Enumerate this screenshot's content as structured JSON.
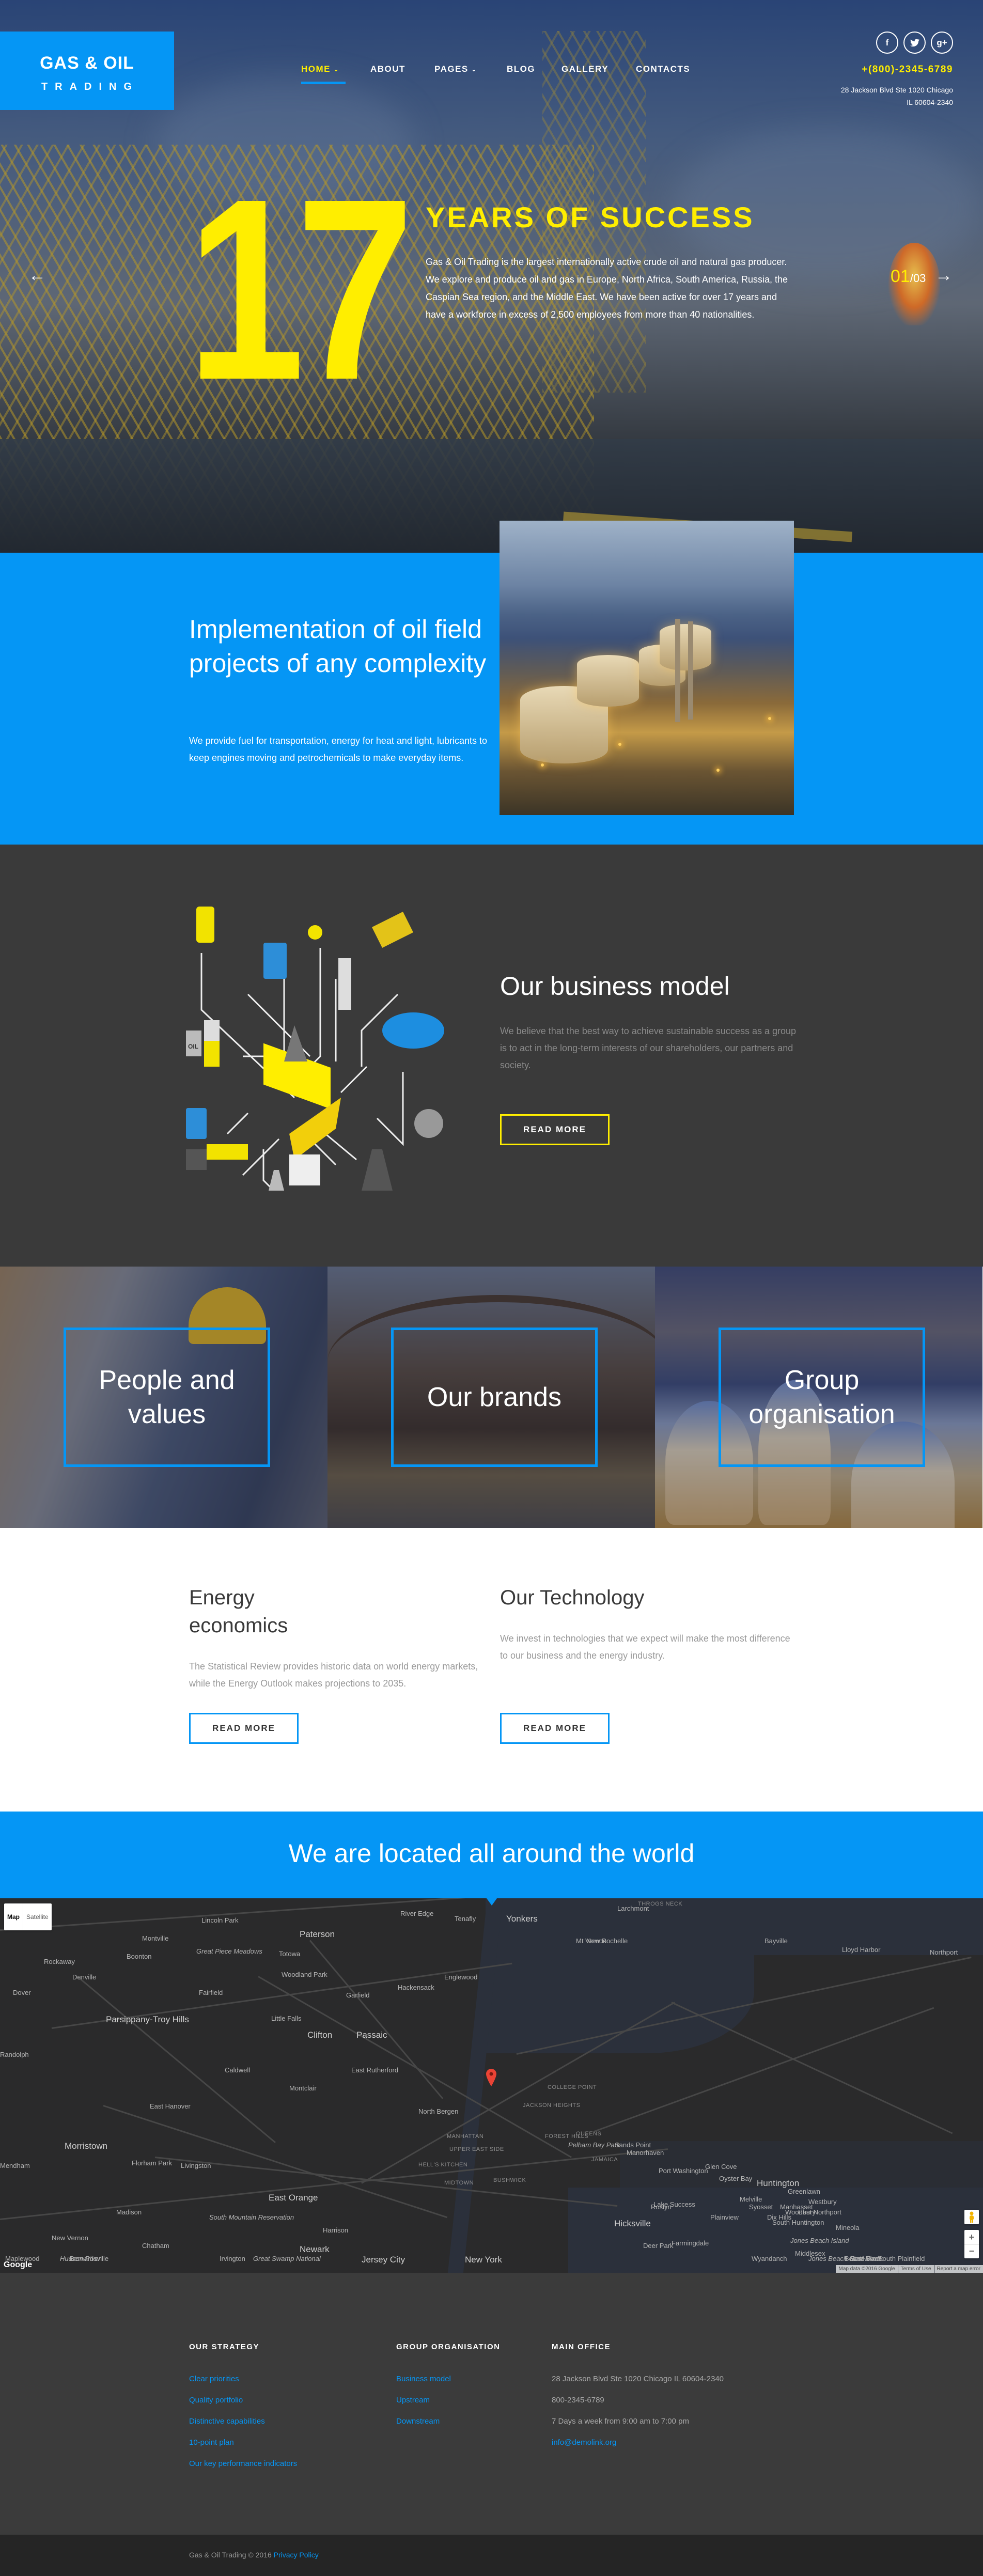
{
  "brand": {
    "line1": "GAS & OIL",
    "line2": "TRADING"
  },
  "nav": {
    "items": [
      {
        "label": "HOME",
        "has_dropdown": true,
        "active": true
      },
      {
        "label": "ABOUT",
        "has_dropdown": false
      },
      {
        "label": "PAGES",
        "has_dropdown": true
      },
      {
        "label": "BLOG",
        "has_dropdown": false
      },
      {
        "label": "GALLERY",
        "has_dropdown": false
      },
      {
        "label": "CONTACTS",
        "has_dropdown": false
      }
    ],
    "caret": "⌄"
  },
  "header": {
    "social": [
      {
        "icon": "facebook-icon",
        "glyph": "f"
      },
      {
        "icon": "twitter-icon",
        "glyph": "t"
      },
      {
        "icon": "google-plus-icon",
        "glyph": "g+"
      }
    ],
    "phone": "+(800)-2345-6789",
    "address_line1": "28 Jackson Blvd Ste 1020 Chicago",
    "address_line2": "IL 60604-2340"
  },
  "hero": {
    "big_number": "17",
    "title": "YEARS OF SUCCESS",
    "text": "Gas & Oil Trading is the largest internationally active crude oil and natural gas producer. We explore and produce oil and gas in Europe, North Africa, South America, Russia, the Caspian Sea region, and the Middle East. We have been active for over 17 years and have a workforce in excess of 2,500 employees from more than 40 nationalities.",
    "slide_current": "01",
    "slide_total": "/03",
    "prev_arrow": "←",
    "next_arrow": "→"
  },
  "implementation": {
    "title": "Implementation of oil field projects of any complexity",
    "text": "We provide fuel for transportation, energy for heat and light, lubricants to keep engines moving and petrochemicals to make everyday items."
  },
  "business_model": {
    "title": "Our business model",
    "text": "We believe that the best way to achieve sustainable success as a group is to act in the long-term interests of our shareholders, our partners and society.",
    "button": "READ MORE",
    "illustration_label": "OIL"
  },
  "tiles": [
    {
      "label": "People and values"
    },
    {
      "label": "Our brands"
    },
    {
      "label": "Group organisation"
    }
  ],
  "info": [
    {
      "title": "Energy economics",
      "text": "The Statistical Review provides historic data on world energy markets, while the Energy Outlook makes projections to 2035.",
      "button": "READ MORE"
    },
    {
      "title": "Our Technology",
      "text": "We invest in technologies that we expect will make the most difference to our business and the energy industry.",
      "button": "READ MORE"
    }
  ],
  "location": {
    "title": "We are located all around the world"
  },
  "map": {
    "type_controls": {
      "map": "Map",
      "satellite": "Satellite",
      "active": "Map"
    },
    "labels": [
      {
        "t": "Lincoln Park",
        "c": ""
      },
      {
        "t": "Montville",
        "c": ""
      },
      {
        "t": "Paterson",
        "c": "big"
      },
      {
        "t": "River Edge",
        "c": ""
      },
      {
        "t": "Tenafly",
        "c": ""
      },
      {
        "t": "Yonkers",
        "c": "big"
      },
      {
        "t": "Larchmont",
        "c": ""
      },
      {
        "t": "Mt Vernon",
        "c": ""
      },
      {
        "t": "New Rochelle",
        "c": ""
      },
      {
        "t": "Bayville",
        "c": ""
      },
      {
        "t": "Lloyd Harbor",
        "c": ""
      },
      {
        "t": "Northport",
        "c": ""
      },
      {
        "t": "Rockaway",
        "c": ""
      },
      {
        "t": "Boonton",
        "c": ""
      },
      {
        "t": "Great Piece Meadows",
        "c": "ital"
      },
      {
        "t": "Totowa",
        "c": ""
      },
      {
        "t": "Denville",
        "c": ""
      },
      {
        "t": "Woodland Park",
        "c": ""
      },
      {
        "t": "Hackensack",
        "c": ""
      },
      {
        "t": "Englewood",
        "c": ""
      },
      {
        "t": "Dover",
        "c": ""
      },
      {
        "t": "Fairfield",
        "c": ""
      },
      {
        "t": "Garfield",
        "c": ""
      },
      {
        "t": "Parsippany-Troy Hills",
        "c": "big"
      },
      {
        "t": "Little Falls",
        "c": ""
      },
      {
        "t": "Clifton",
        "c": "big"
      },
      {
        "t": "Passaic",
        "c": "big"
      },
      {
        "t": "Randolph",
        "c": ""
      },
      {
        "t": "Caldwell",
        "c": ""
      },
      {
        "t": "East Rutherford",
        "c": ""
      },
      {
        "t": "Montclair",
        "c": ""
      },
      {
        "t": "North Bergen",
        "c": ""
      },
      {
        "t": "East Hanover",
        "c": ""
      },
      {
        "t": "MANHATTAN",
        "c": "dist"
      },
      {
        "t": "UPPER EAST SIDE",
        "c": "dist"
      },
      {
        "t": "HELL'S KITCHEN",
        "c": "dist"
      },
      {
        "t": "MIDTOWN",
        "c": "dist"
      },
      {
        "t": "Morristown",
        "c": "big"
      },
      {
        "t": "Florham Park",
        "c": ""
      },
      {
        "t": "Livingston",
        "c": ""
      },
      {
        "t": "Mendham",
        "c": ""
      },
      {
        "t": "East Orange",
        "c": "big"
      },
      {
        "t": "Madison",
        "c": ""
      },
      {
        "t": "South Mountain Reservation",
        "c": "ital"
      },
      {
        "t": "Harrison",
        "c": ""
      },
      {
        "t": "New Vernon",
        "c": ""
      },
      {
        "t": "Chatham",
        "c": ""
      },
      {
        "t": "Newark",
        "c": "big"
      },
      {
        "t": "Jersey City",
        "c": "big"
      },
      {
        "t": "New York",
        "c": "big"
      },
      {
        "t": "Maplewood",
        "c": ""
      },
      {
        "t": "Irvington",
        "c": ""
      },
      {
        "t": "Great Swamp National",
        "c": "ital"
      },
      {
        "t": "Bernardsville",
        "c": ""
      },
      {
        "t": "COLLEGE POINT",
        "c": "dist"
      },
      {
        "t": "JACKSON HEIGHTS",
        "c": "dist"
      },
      {
        "t": "QUEENS",
        "c": "dist"
      },
      {
        "t": "FOREST HILLS",
        "c": "dist"
      },
      {
        "t": "JAMAICA",
        "c": "dist"
      },
      {
        "t": "BUSHWICK",
        "c": "dist"
      },
      {
        "t": "THROGS NECK",
        "c": "dist"
      },
      {
        "t": "Pelham Bay Park",
        "c": "ital"
      },
      {
        "t": "Sands Point",
        "c": ""
      },
      {
        "t": "Manorhaven",
        "c": ""
      },
      {
        "t": "Port Washington",
        "c": ""
      },
      {
        "t": "Glen Cove",
        "c": ""
      },
      {
        "t": "Oyster Bay",
        "c": ""
      },
      {
        "t": "Huntington",
        "c": "big"
      },
      {
        "t": "Greenlawn",
        "c": ""
      },
      {
        "t": "East Northport",
        "c": ""
      },
      {
        "t": "Syosset",
        "c": ""
      },
      {
        "t": "Woodbury",
        "c": ""
      },
      {
        "t": "South Huntington",
        "c": ""
      },
      {
        "t": "Manhasset",
        "c": ""
      },
      {
        "t": "Roslyn",
        "c": ""
      },
      {
        "t": "Lake Success",
        "c": ""
      },
      {
        "t": "Hicksville",
        "c": "big"
      },
      {
        "t": "Plainview",
        "c": ""
      },
      {
        "t": "Melville",
        "c": ""
      },
      {
        "t": "Dix Hills",
        "c": ""
      },
      {
        "t": "Westbury",
        "c": ""
      },
      {
        "t": "Mineola",
        "c": ""
      },
      {
        "t": "Farmingdale",
        "c": ""
      },
      {
        "t": "Deer Park",
        "c": ""
      },
      {
        "t": "Wyandanch",
        "c": ""
      },
      {
        "t": "Jones Beach State Park",
        "c": "ital"
      },
      {
        "t": "Jones Beach Island",
        "c": "ital"
      },
      {
        "t": "Middlesex",
        "c": ""
      },
      {
        "t": "South Plainfield",
        "c": ""
      },
      {
        "t": "Bound Brook",
        "c": ""
      },
      {
        "t": "East River",
        "c": "ital"
      },
      {
        "t": "Hudson River",
        "c": "ital"
      }
    ],
    "attribution": [
      "Map data ©2016 Google",
      "Terms of Use",
      "Report a map error"
    ],
    "google_logo": "Google",
    "zoom_in": "+",
    "zoom_out": "−"
  },
  "footer": {
    "columns": [
      {
        "heading": "OUR STRATEGY",
        "links": [
          "Clear priorities",
          "Quality portfolio",
          "Distinctive capabilities",
          "10-point plan",
          "Our key performance indicators"
        ]
      },
      {
        "heading": "GROUP ORGANISATION",
        "links": [
          "Business model",
          "Upstream",
          "Downstream"
        ]
      },
      {
        "heading": "MAIN OFFICE",
        "items": [
          "28 Jackson Blvd Ste 1020 Chicago IL 60604-2340",
          "800-2345-6789",
          "7 Days a week from 9:00 am to 7:00 pm"
        ],
        "email": "info@demolink.org"
      }
    ],
    "copyright": "Gas & Oil Trading © 2016",
    "privacy": "Privacy Policy"
  },
  "colors": {
    "accent_blue": "#0596f5",
    "accent_yellow": "#ffee00",
    "dark": "#3a3a3a",
    "footer_bottom": "#252525"
  }
}
